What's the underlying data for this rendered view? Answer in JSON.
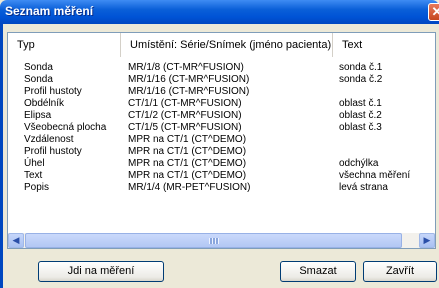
{
  "window": {
    "title": "Seznam měření",
    "close_glyph": "✕"
  },
  "table": {
    "headers": [
      "Typ",
      "Umístění: Série/Snímek (jméno pacienta)",
      "Text"
    ],
    "rows": [
      {
        "typ": "Sonda",
        "umisteni": "MR/1/8  (CT-MR^FUSION)",
        "text": "sonda č.1"
      },
      {
        "typ": "Sonda",
        "umisteni": "MR/1/16  (CT-MR^FUSION)",
        "text": "sonda č.2"
      },
      {
        "typ": "Profil hustoty",
        "umisteni": "MR/1/16  (CT-MR^FUSION)",
        "text": ""
      },
      {
        "typ": "Obdélník",
        "umisteni": "CT/1/1  (CT-MR^FUSION)",
        "text": "oblast č.1"
      },
      {
        "typ": "Elipsa",
        "umisteni": "CT/1/2  (CT-MR^FUSION)",
        "text": "oblast č.2"
      },
      {
        "typ": "Všeobecná plocha",
        "umisteni": "CT/1/5  (CT-MR^FUSION)",
        "text": "oblast č.3"
      },
      {
        "typ": "Vzdálenost",
        "umisteni": "MPR na CT/1  (CT^DEMO)",
        "text": ""
      },
      {
        "typ": "Profil hustoty",
        "umisteni": "MPR na CT/1  (CT^DEMO)",
        "text": ""
      },
      {
        "typ": "Úhel",
        "umisteni": "MPR na CT/1  (CT^DEMO)",
        "text": "odchýlka"
      },
      {
        "typ": "Text",
        "umisteni": "MPR na CT/1  (CT^DEMO)",
        "text": "všechna měření"
      },
      {
        "typ": "Popis",
        "umisteni": "MR/1/4  (MR-PET^FUSION)",
        "text": "levá strana"
      }
    ]
  },
  "scrollbar": {
    "left_glyph": "◀",
    "right_glyph": "▶",
    "left_icon": "scroll-left-arrow",
    "right_icon": "scroll-right-arrow"
  },
  "buttons": {
    "goto": "Jdi na měření",
    "delete": "Smazat",
    "close": "Zavřít"
  },
  "colors": {
    "titlebar": "#0053d6",
    "dialog_bg": "#ece9d8",
    "close_button": "#c5461f"
  }
}
